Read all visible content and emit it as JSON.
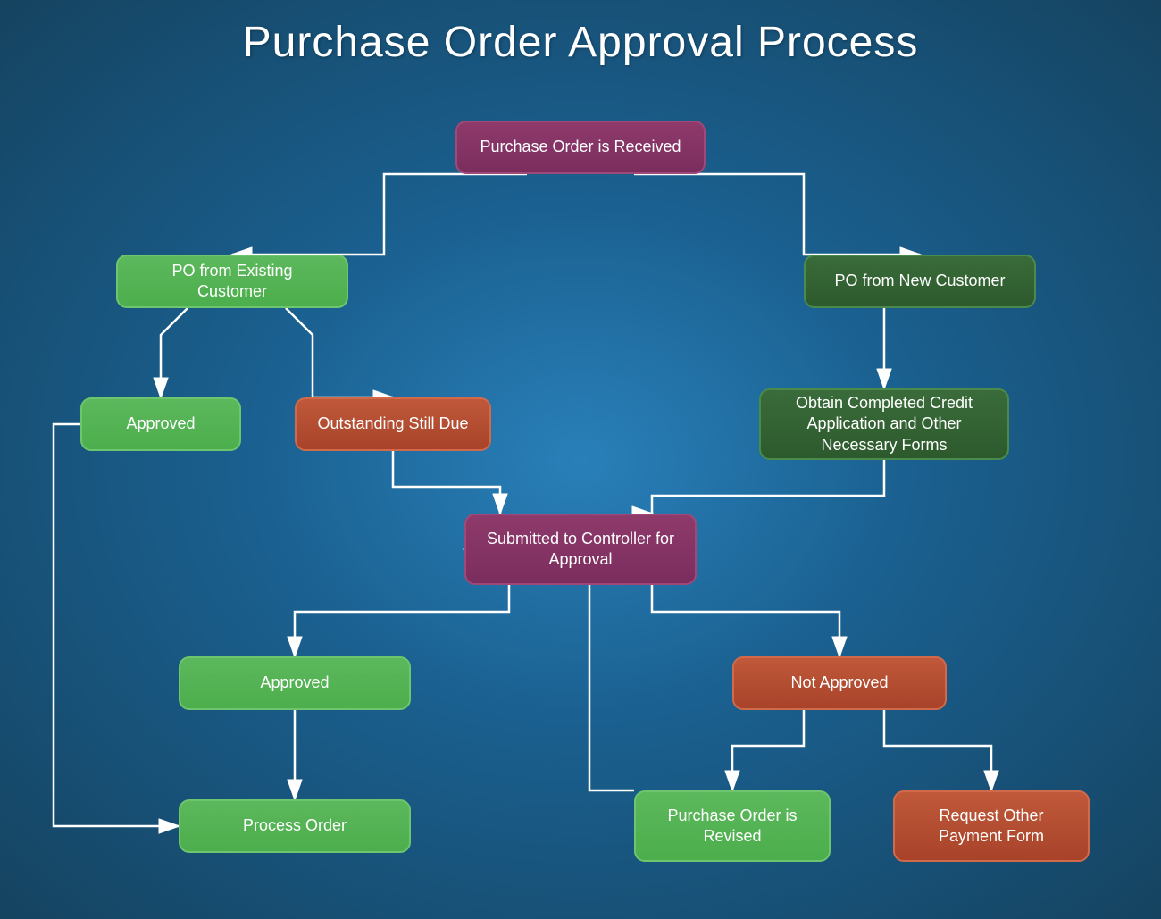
{
  "page": {
    "title": "Purchase Order Approval Process",
    "background": {
      "top_color": "#1c4f7a",
      "bottom_color": "#1a6b3c"
    }
  },
  "nodes": {
    "received": {
      "label": "Purchase Order is Received",
      "type": "purple"
    },
    "existing": {
      "label": "PO from Existing Customer",
      "type": "green_light"
    },
    "new": {
      "label": "PO from New Customer",
      "type": "green_dark"
    },
    "approved_1": {
      "label": "Approved",
      "type": "green_light"
    },
    "outstanding": {
      "label": "Outstanding Still Due",
      "type": "orange"
    },
    "credit": {
      "label": "Obtain Completed Credit Application and Other Necessary Forms",
      "type": "green_dark"
    },
    "controller": {
      "label": "Submitted to Controller for Approval",
      "type": "purple"
    },
    "approved_2": {
      "label": "Approved",
      "type": "green_light"
    },
    "not_approved": {
      "label": "Not Approved",
      "type": "orange"
    },
    "process": {
      "label": "Process Order",
      "type": "green_light"
    },
    "revised": {
      "label": "Purchase Order is Revised",
      "type": "green_light"
    },
    "payment": {
      "label": "Request Other Payment Form",
      "type": "orange"
    }
  },
  "arrows": {
    "color": "#ffffff",
    "head_size": 10
  }
}
